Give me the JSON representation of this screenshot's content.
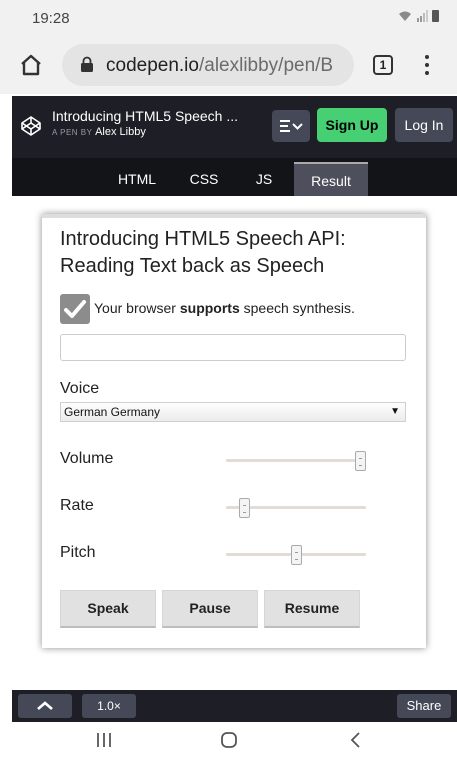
{
  "status_bar": {
    "time": "19:28"
  },
  "browser": {
    "url_host": "codepen.io",
    "url_path": "/alexlibby/pen/B",
    "tab_count": "1"
  },
  "codepen": {
    "title": "Introducing HTML5 Speech ...",
    "byline_prefix": "A PEN BY",
    "author": "Alex Libby",
    "signup_label": "Sign Up",
    "login_label": "Log In",
    "tabs": [
      {
        "label": "HTML"
      },
      {
        "label": "CSS"
      },
      {
        "label": "JS"
      },
      {
        "label": "Result"
      }
    ],
    "active_tab": "Result",
    "zoom_label": "1.0×",
    "share_label": "Share"
  },
  "demo": {
    "title": "Introducing HTML5 Speech API: Reading Text back as Speech",
    "support_prefix": "Your browser ",
    "support_bold": "supports",
    "support_suffix": " speech synthesis.",
    "text_value": "",
    "voice_label": "Voice",
    "voice_selected": "German Germany",
    "volume_label": "Volume",
    "rate_label": "Rate",
    "pitch_label": "Pitch",
    "volume_level": 1.0,
    "rate_level": 0.1,
    "pitch_level": 0.5,
    "speak_label": "Speak",
    "pause_label": "Pause",
    "resume_label": "Resume"
  },
  "colors": {
    "codepen_dark": "#1e1f26",
    "signup_green": "#47cf73",
    "active_tab": "#4d4f5c"
  }
}
